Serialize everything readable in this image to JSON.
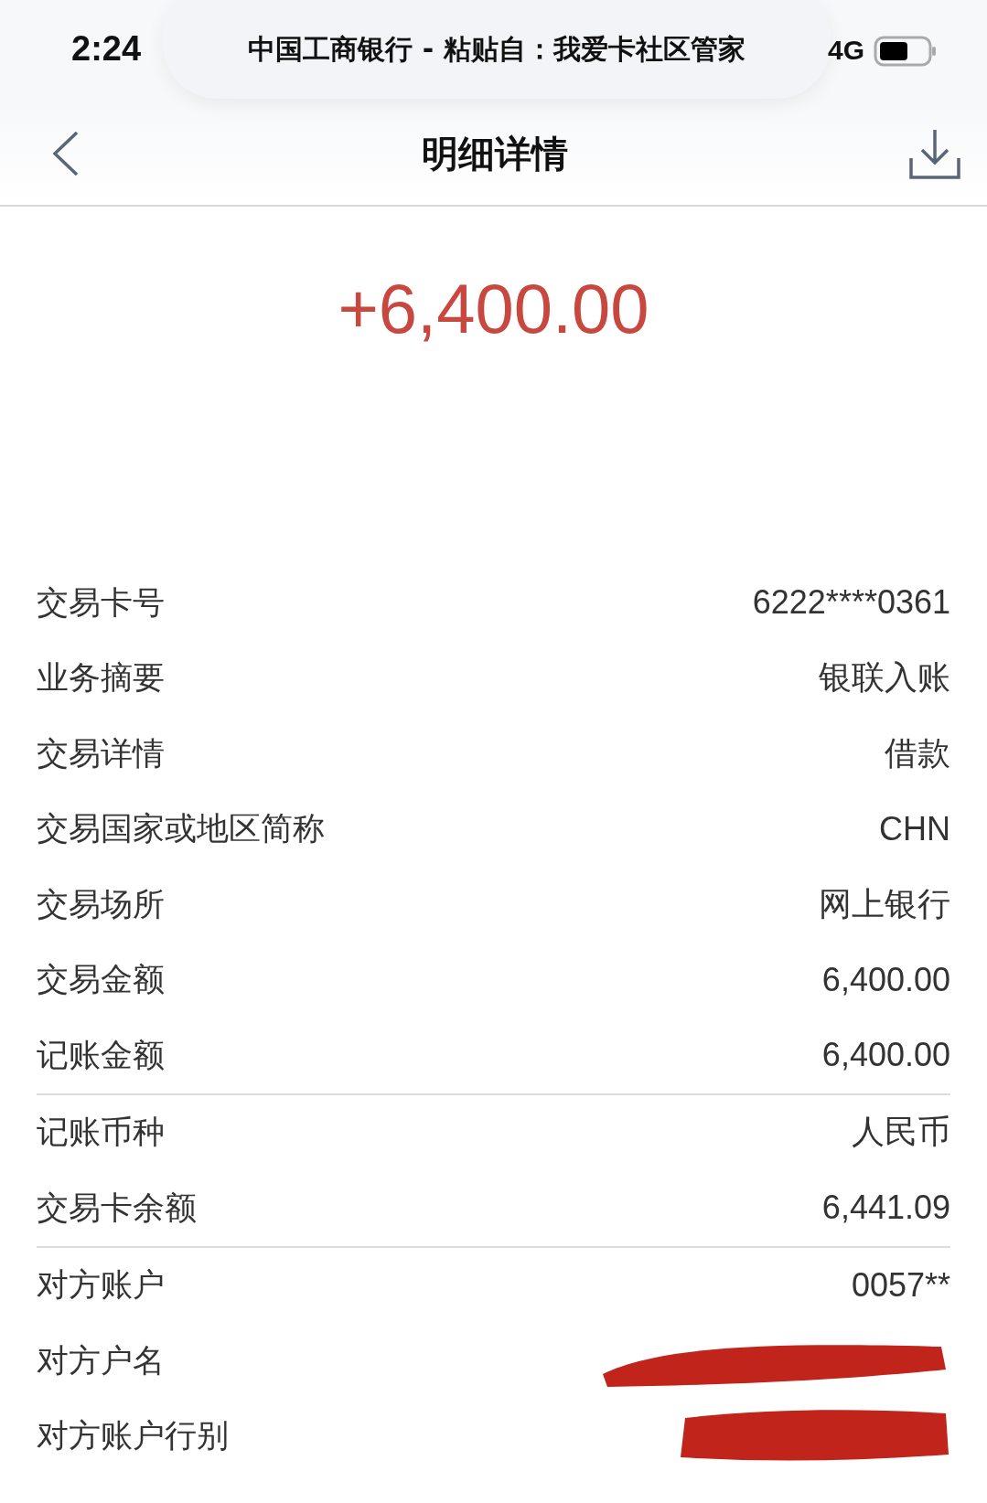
{
  "status_bar": {
    "time": "2:24",
    "banner": "中国工商银行 - 粘贴自：我爱卡社区管家",
    "network": "4G"
  },
  "nav": {
    "title": "明细详情"
  },
  "amount": "+6,400.00",
  "groups": [
    {
      "rows": [
        {
          "label": "交易卡号",
          "value": "6222****0361"
        },
        {
          "label": "业务摘要",
          "value": "银联入账"
        },
        {
          "label": "交易详情",
          "value": "借款"
        },
        {
          "label": "交易国家或地区简称",
          "value": "CHN"
        },
        {
          "label": "交易场所",
          "value": "网上银行"
        },
        {
          "label": "交易金额",
          "value": "6,400.00"
        },
        {
          "label": "记账金额",
          "value": "6,400.00"
        }
      ]
    },
    {
      "rows": [
        {
          "label": "记账币种",
          "value": "人民币"
        },
        {
          "label": "交易卡余额",
          "value": "6,441.09"
        }
      ]
    },
    {
      "rows": [
        {
          "label": "对方账户",
          "value": "0057**"
        },
        {
          "label": "对方户名",
          "redacted": true
        },
        {
          "label": "对方账户行别",
          "redacted": true
        }
      ]
    }
  ]
}
